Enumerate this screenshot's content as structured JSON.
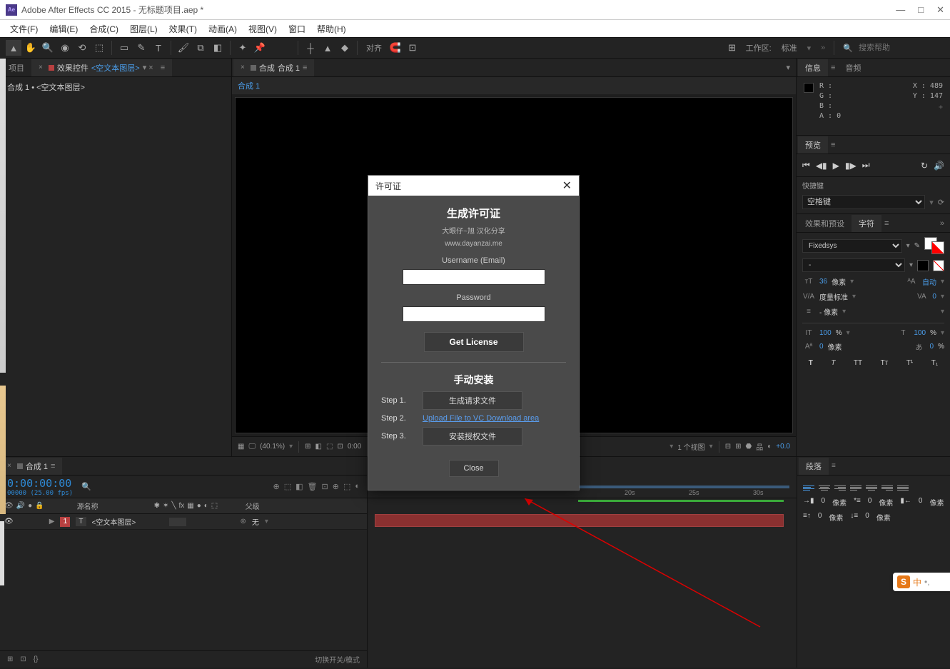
{
  "titlebar": {
    "logo_text": "Ae",
    "title": "Adobe After Effects CC 2015 - 无标题项目.aep *"
  },
  "menubar": [
    "文件(F)",
    "编辑(E)",
    "合成(C)",
    "图层(L)",
    "效果(T)",
    "动画(A)",
    "视图(V)",
    "窗口",
    "帮助(H)"
  ],
  "toolbar": {
    "align_label": "对齐",
    "workspace_label": "工作区:",
    "workspace_value": "标准",
    "search_placeholder": "搜索帮助"
  },
  "project_panel": {
    "tab_project": "项目",
    "tab_effect": "效果控件",
    "effect_link": "<空文本图层>",
    "comp_line": "合成 1 • <空文本图层>"
  },
  "viewer": {
    "tab_prefix": "合成",
    "tab_name": "合成 1",
    "crumb": "合成 1",
    "zoom": "(40.1%)",
    "time": "0:00",
    "view_count": "1 个视图",
    "exposure": "+0.0"
  },
  "info_panel": {
    "tab_info": "信息",
    "tab_audio": "音频",
    "r": "R :",
    "g": "G :",
    "b": "B :",
    "a": "A : 0",
    "x": "X : 489",
    "y": "Y : 147"
  },
  "preview_panel": {
    "tab": "预览"
  },
  "shortcut_panel": {
    "label": "快捷键",
    "value": "空格键"
  },
  "effects_panel": {
    "tab_effects": "效果和预设",
    "tab_char": "字符"
  },
  "char_panel": {
    "font": "Fixedsys",
    "style": "-",
    "size": "36",
    "size_unit": "像素",
    "leading": "自动",
    "metrics": "度量标准",
    "kern": "0",
    "unit": "- 像素",
    "vscale": "100",
    "vscale_unit": "%",
    "hscale": "100",
    "hscale_unit": "%",
    "baseline": "0",
    "baseline_unit": "像素",
    "tsume": "0",
    "tsume_unit": "%",
    "btn_bold": "T",
    "btn_italic": "T",
    "btn_caps": "TT",
    "btn_small": "Tᴛ",
    "btn_sup": "T¹",
    "btn_sub": "T₁"
  },
  "timeline": {
    "tab_comp": "合成 1",
    "timecode": "0:00:00:00",
    "frame_info": "00000 (25.00 fps)",
    "col_source": "源名称",
    "col_parent": "父级",
    "layer_num": "1",
    "layer_icon": "T",
    "layer_name": "<空文本图层>",
    "parent_value": "无",
    "footer": "切换开关/模式",
    "tick_20s": "20s",
    "tick_25s": "25s",
    "tick_30s": "30s"
  },
  "para_panel": {
    "tab": "段落",
    "indent1": "0",
    "indent2": "0",
    "indent3": "0",
    "space1": "0",
    "space2": "0",
    "unit": "像素"
  },
  "dialog": {
    "title": "许可证",
    "heading": "生成许可证",
    "sub1": "大眼仔~旭 汉化分享",
    "sub2": "www.dayanzai.me",
    "username_label": "Username (Email)",
    "password_label": "Password",
    "get_license": "Get License",
    "manual_heading": "手动安装",
    "step1": "Step 1.",
    "step1_btn": "生成请求文件",
    "step2": "Step 2.",
    "step2_link": "Upload File to VC Download area",
    "step3": "Step 3.",
    "step3_btn": "安装授权文件",
    "close": "Close"
  },
  "sogou": {
    "text": "中"
  }
}
